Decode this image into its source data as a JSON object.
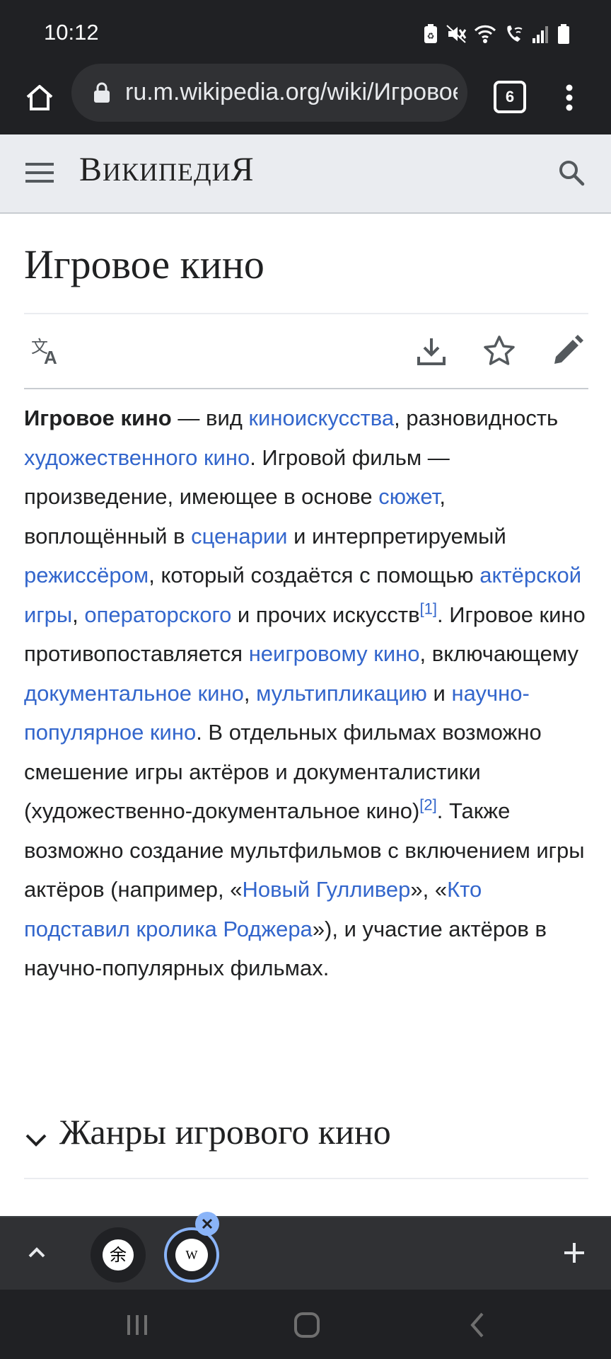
{
  "status_bar": {
    "time": "10:12"
  },
  "browser": {
    "url": "ru.m.wikipedia.org/wiki/Игровое_кино",
    "tab_count": "6"
  },
  "wiki_header": {
    "wordmark": "Википедия"
  },
  "page": {
    "title": "Игровое кино",
    "paragraph": [
      {
        "t": "b",
        "text": "Игровое кино"
      },
      {
        "t": "s",
        "text": " — вид "
      },
      {
        "t": "a",
        "text": "киноискусства"
      },
      {
        "t": "s",
        "text": ", разновидность "
      },
      {
        "t": "a",
        "text": "художественного кино"
      },
      {
        "t": "s",
        "text": ". Игровой фильм — произведение, имеющее в основе "
      },
      {
        "t": "a",
        "text": "сюжет"
      },
      {
        "t": "s",
        "text": ", воплощённый в "
      },
      {
        "t": "a",
        "text": "сценарии"
      },
      {
        "t": "s",
        "text": " и интерпретируемый "
      },
      {
        "t": "a",
        "text": "режиссёром"
      },
      {
        "t": "s",
        "text": ", который создаётся с помощью "
      },
      {
        "t": "a",
        "text": "актёрской игры"
      },
      {
        "t": "s",
        "text": ", "
      },
      {
        "t": "a",
        "text": "операторского"
      },
      {
        "t": "s",
        "text": " и прочих искусств"
      },
      {
        "t": "sup",
        "text": "[1]"
      },
      {
        "t": "s",
        "text": ". Игровое кино противопоставляется "
      },
      {
        "t": "a",
        "text": "неигровому кино"
      },
      {
        "t": "s",
        "text": ", включающему "
      },
      {
        "t": "a",
        "text": "документальное кино"
      },
      {
        "t": "s",
        "text": ", "
      },
      {
        "t": "a",
        "text": "мультипликацию"
      },
      {
        "t": "s",
        "text": " и "
      },
      {
        "t": "a",
        "text": "научно-популярное кино"
      },
      {
        "t": "s",
        "text": ". В отдельных фильмах возможно смешение игры актёров и документалистики (художественно-документальное кино)"
      },
      {
        "t": "sup",
        "text": "[2]"
      },
      {
        "t": "s",
        "text": ". Также возможно создание мультфильмов с включением игры актёров (например, «"
      },
      {
        "t": "a",
        "text": "Новый Гулливер"
      },
      {
        "t": "s",
        "text": "», «"
      },
      {
        "t": "a",
        "text": "Кто подставил кролика Роджера"
      },
      {
        "t": "s",
        "text": "»), и участие актёров в научно-популярных фильмах."
      }
    ],
    "section_heading": "Жанры игрового кино"
  },
  "bubble_bar": {
    "bubble1_glyph": "余",
    "bubble2_glyph": "W"
  }
}
